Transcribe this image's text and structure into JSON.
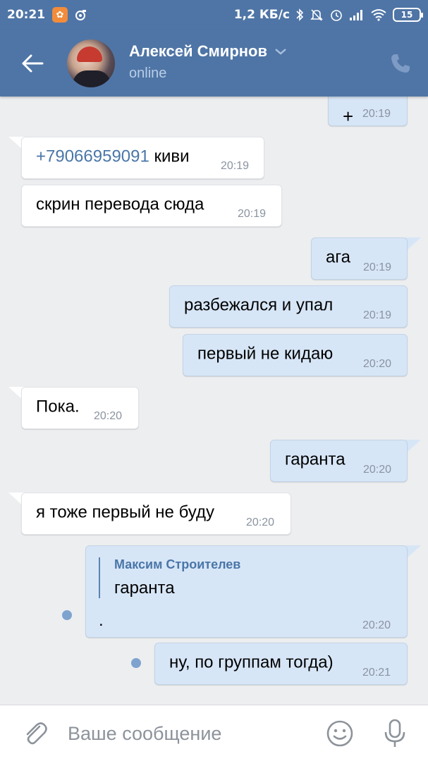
{
  "status_bar": {
    "time": "20:21",
    "network_speed": "1,2 КБ/с",
    "battery": "15",
    "icons": [
      "notification-app-icon",
      "tool-icon",
      "bluetooth-icon",
      "mute-icon",
      "alarm-icon",
      "signal-icon",
      "wifi-icon",
      "battery-icon"
    ]
  },
  "header": {
    "contact_name": "Алексей Смирнов",
    "contact_status": "online",
    "icons": [
      "back-arrow-icon",
      "chevron-down-icon",
      "phone-icon"
    ]
  },
  "messages": [
    {
      "direction": "out",
      "text": "+",
      "time": "20:19"
    },
    {
      "direction": "in",
      "phone": "+79066959091",
      "text": " киви",
      "time": "20:19"
    },
    {
      "direction": "in",
      "text": "скрин перевода сюда",
      "time": "20:19"
    },
    {
      "direction": "out",
      "text": "ага",
      "time": "20:19"
    },
    {
      "direction": "out",
      "text": "разбежался и упал",
      "time": "20:19"
    },
    {
      "direction": "out",
      "text": "первый не кидаю",
      "time": "20:20"
    },
    {
      "direction": "in",
      "text": "Пока.",
      "time": "20:20"
    },
    {
      "direction": "out",
      "text": "гаранта",
      "time": "20:20"
    },
    {
      "direction": "in",
      "text": "я тоже первый не буду",
      "time": "20:20"
    },
    {
      "direction": "out",
      "quote_author": "Максим Строителев",
      "quote_text": "гаранта",
      "text": ".",
      "time": "20:20",
      "unread": true
    },
    {
      "direction": "out",
      "text": "ну, по группам тогда)",
      "time": "20:21",
      "unread": true
    }
  ],
  "composer": {
    "placeholder": "Ваше сообщение",
    "icons": [
      "attach-icon",
      "emoji-icon",
      "microphone-icon"
    ]
  },
  "colors": {
    "header_bg": "#4f75a6",
    "chat_bg": "#edeef0",
    "incoming_bubble": "#ffffff",
    "outgoing_bubble": "#d7e6f7",
    "link": "#4a76a8"
  }
}
